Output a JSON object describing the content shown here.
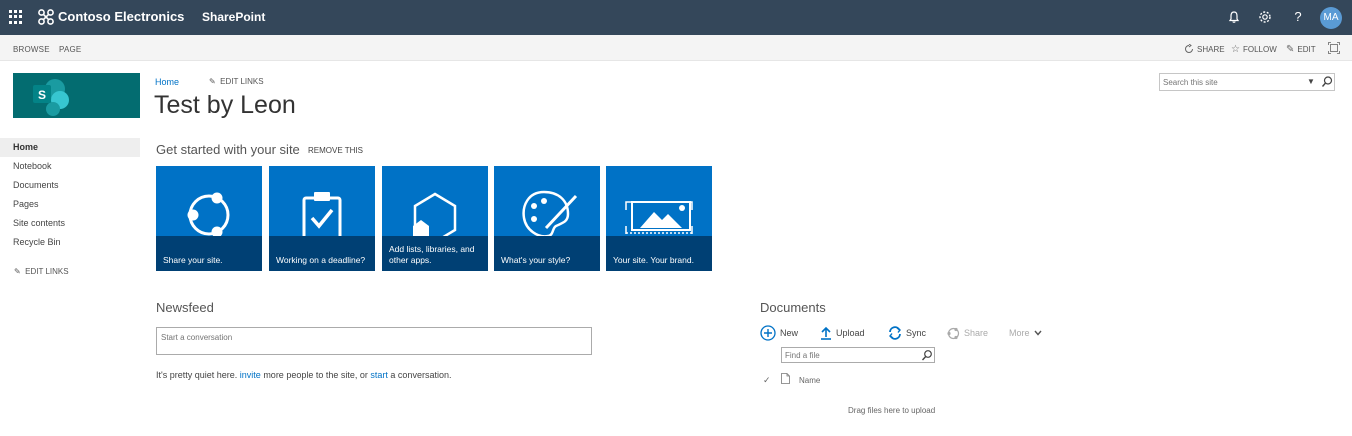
{
  "suite_bar": {
    "brand_name": "Contoso Electronics",
    "app_name": "SharePoint",
    "avatar_initials": "MA",
    "icons": [
      "waffle-icon",
      "brand-logo-icon",
      "notification-bell-icon",
      "settings-gear-icon",
      "help-icon"
    ]
  },
  "ribbon": {
    "tabs": [
      "BROWSE",
      "PAGE"
    ],
    "actions": {
      "share": "SHARE",
      "follow": "FOLLOW",
      "edit": "EDIT"
    }
  },
  "top_nav": {
    "home": "Home",
    "edit_links": "EDIT LINKS"
  },
  "site": {
    "title": "Test by Leon"
  },
  "search": {
    "placeholder": "Search this site"
  },
  "left_nav": {
    "items": [
      "Home",
      "Notebook",
      "Documents",
      "Pages",
      "Site contents",
      "Recycle Bin"
    ],
    "edit_links": "EDIT LINKS"
  },
  "get_started": {
    "title": "Get started with your site",
    "remove": "REMOVE THIS",
    "tiles": [
      {
        "caption": "Share your site.",
        "icon": "share-icon"
      },
      {
        "caption": "Working on a deadline?",
        "icon": "clipboard-check-icon"
      },
      {
        "caption": "Add lists, libraries, and other apps.",
        "icon": "add-apps-icon"
      },
      {
        "caption": "What's your style?",
        "icon": "palette-icon"
      },
      {
        "caption": "Your site. Your brand.",
        "icon": "image-brand-icon"
      }
    ]
  },
  "newsfeed": {
    "title": "Newsfeed",
    "placeholder": "Start a conversation",
    "quiet_prefix": "It's pretty quiet here.",
    "invite": "invite",
    "quiet_middle": "more people to the site, or",
    "start": "start",
    "quiet_suffix": "a conversation."
  },
  "documents": {
    "title": "Documents",
    "commands": {
      "new": "New",
      "upload": "Upload",
      "sync": "Sync",
      "share": "Share",
      "more": "More"
    },
    "find_placeholder": "Find a file",
    "column_name": "Name",
    "drag_hint": "Drag files here to upload"
  },
  "colors": {
    "suite_bar": "#34475a",
    "tile_blue": "#0072c6",
    "site_logo": "#036c70",
    "link": "#0072c6"
  }
}
